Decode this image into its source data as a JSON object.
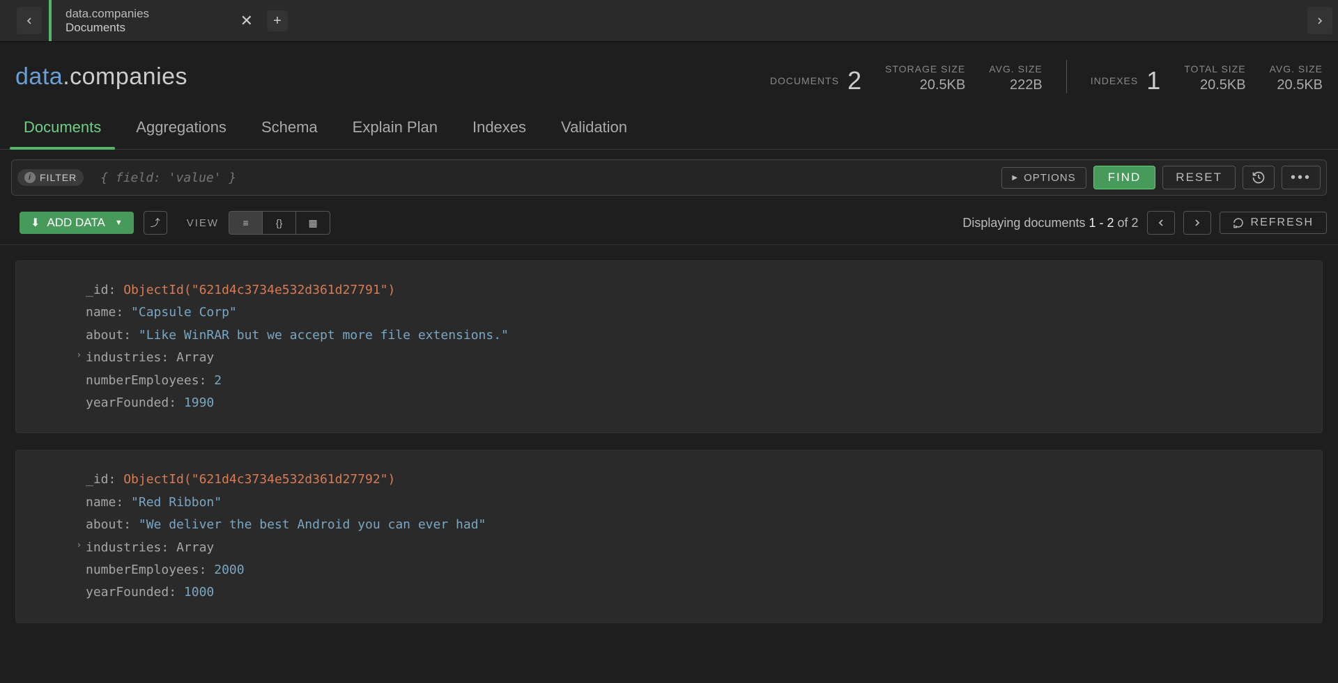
{
  "tab": {
    "title": "data.companies",
    "subtitle": "Documents"
  },
  "header": {
    "db": "data",
    "collection": ".companies",
    "documents_label": "DOCUMENTS",
    "documents_count": "2",
    "storage_size_label": "STORAGE SIZE",
    "storage_size_value": "20.5KB",
    "avg_size_label": "AVG. SIZE",
    "avg_size_value": "222B",
    "indexes_label": "INDEXES",
    "indexes_count": "1",
    "total_size_label": "TOTAL SIZE",
    "total_size_value": "20.5KB",
    "idx_avg_size_label": "AVG. SIZE",
    "idx_avg_size_value": "20.5KB"
  },
  "navtabs": {
    "documents": "Documents",
    "aggregations": "Aggregations",
    "schema": "Schema",
    "explain": "Explain Plan",
    "indexes": "Indexes",
    "validation": "Validation"
  },
  "filter": {
    "badge": "FILTER",
    "placeholder": "{ field: 'value' }",
    "options": "OPTIONS",
    "find": "FIND",
    "reset": "RESET"
  },
  "toolbar": {
    "add_data": "ADD DATA",
    "view_label": "VIEW",
    "displaying_prefix": "Displaying documents ",
    "range": "1 - 2",
    "of": " of ",
    "total": "2",
    "refresh": "REFRESH"
  },
  "documents": [
    {
      "id_key": "_id",
      "id_fn": "ObjectId(\"621d4c3734e532d361d27791\")",
      "name_key": "name",
      "name_val": "\"Capsule Corp\"",
      "about_key": "about",
      "about_val": "\"Like WinRAR but we accept more file extensions.\"",
      "industries_key": "industries",
      "industries_type": "Array",
      "emp_key": "numberEmployees",
      "emp_val": "2",
      "year_key": "yearFounded",
      "year_val": "1990"
    },
    {
      "id_key": "_id",
      "id_fn": "ObjectId(\"621d4c3734e532d361d27792\")",
      "name_key": "name",
      "name_val": "\"Red Ribbon\"",
      "about_key": "about",
      "about_val": "\"We deliver the best Android you can ever had\"",
      "industries_key": "industries",
      "industries_type": "Array",
      "emp_key": "numberEmployees",
      "emp_val": "2000",
      "year_key": "yearFounded",
      "year_val": "1000"
    }
  ]
}
